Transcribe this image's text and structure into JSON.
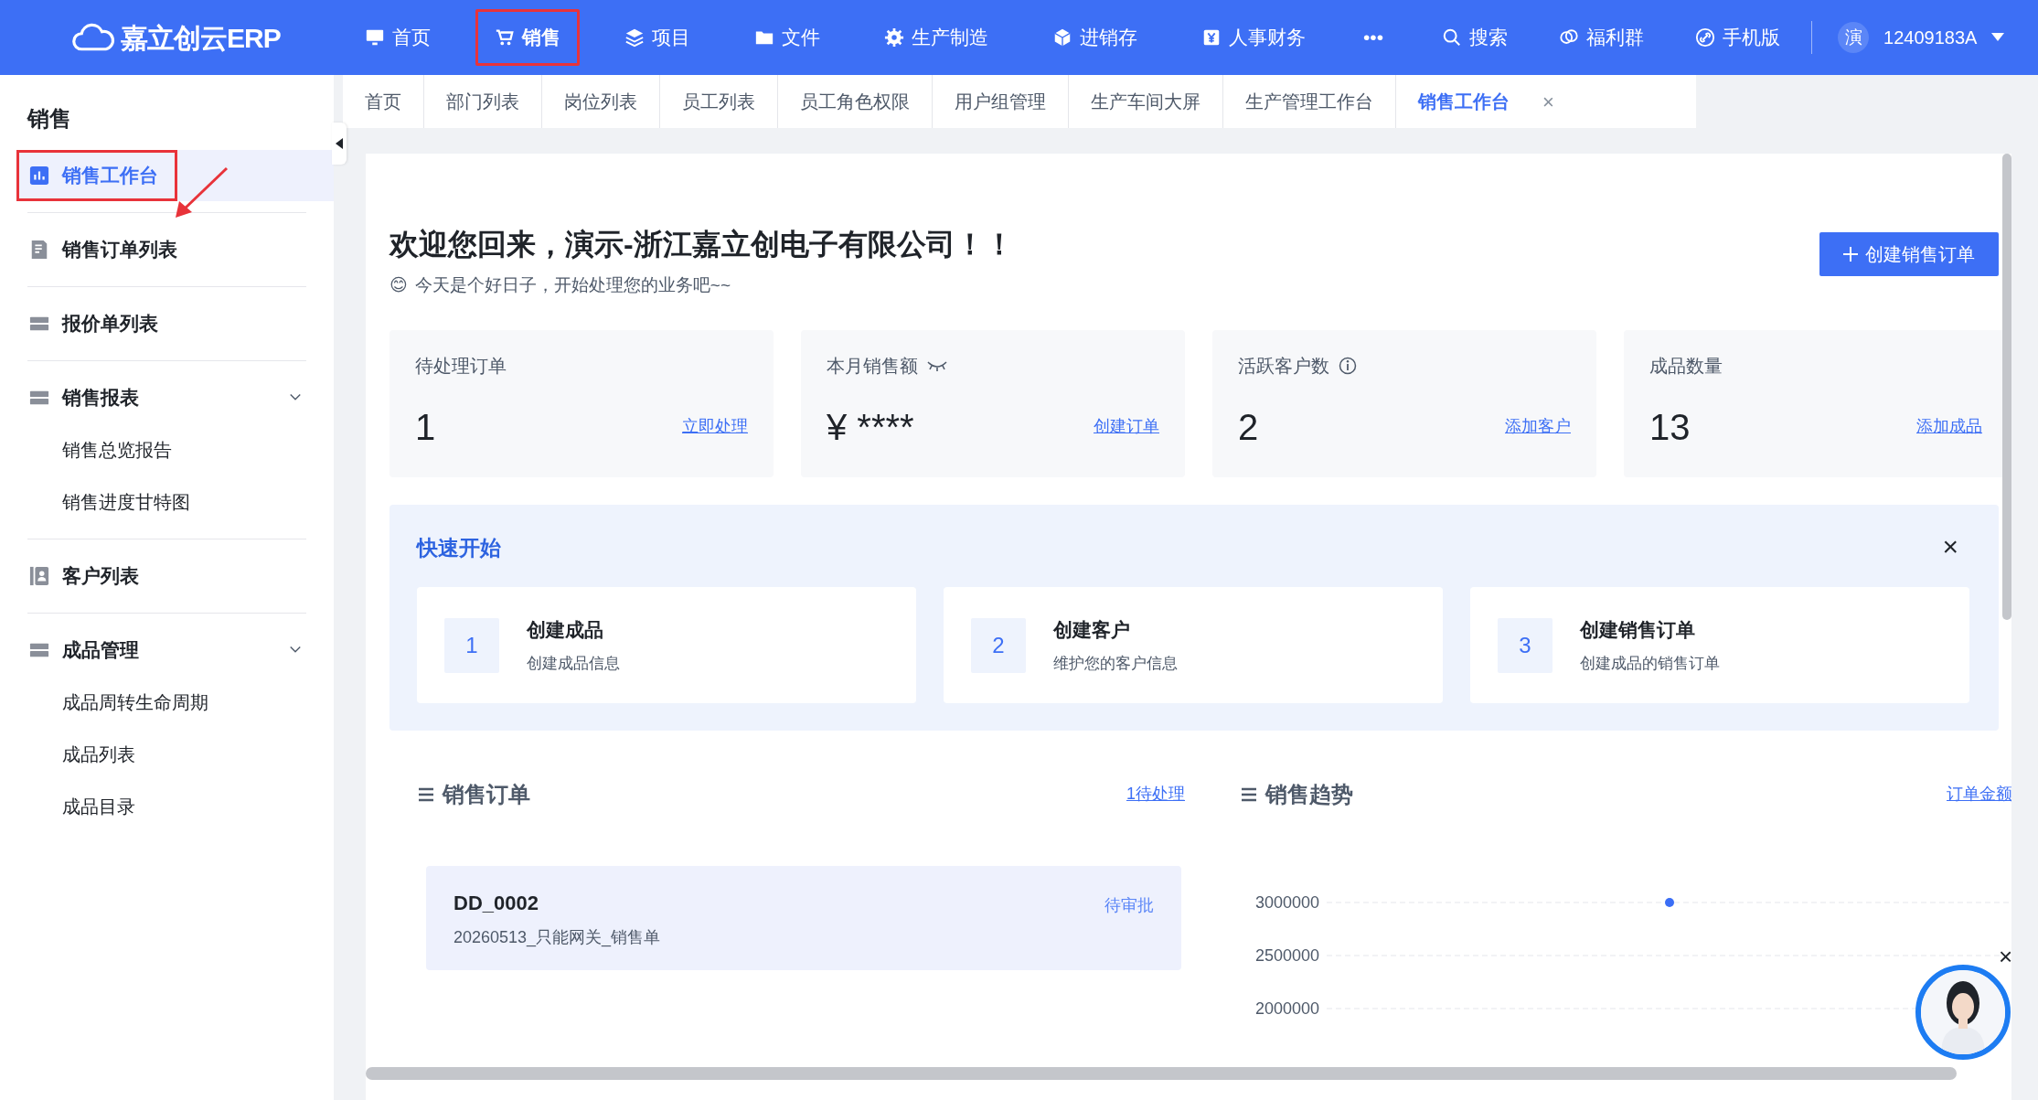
{
  "app": {
    "logo": "嘉立创云ERP"
  },
  "top_nav": [
    {
      "label": "首页",
      "selected": false,
      "highlighted": false
    },
    {
      "label": "销售",
      "selected": true,
      "highlighted": true
    },
    {
      "label": "项目",
      "selected": false,
      "highlighted": false
    },
    {
      "label": "文件",
      "selected": false,
      "highlighted": false
    },
    {
      "label": "生产制造",
      "selected": false,
      "highlighted": false
    },
    {
      "label": "进销存",
      "selected": false,
      "highlighted": false
    },
    {
      "label": "人事财务",
      "selected": false,
      "highlighted": false
    }
  ],
  "more": "•••",
  "tools": [
    {
      "label": "搜索"
    },
    {
      "label": "福利群"
    },
    {
      "label": "手机版"
    }
  ],
  "user": {
    "avatar": "演",
    "name": "12409183A"
  },
  "sidebar": {
    "title": "销售",
    "items": [
      {
        "kind": "link",
        "label": "销售工作台",
        "selected": true,
        "highlighted": true
      },
      {
        "kind": "link",
        "label": "销售订单列表",
        "selected": false,
        "highlighted": false
      },
      {
        "kind": "link",
        "label": "报价单列表",
        "selected": false,
        "highlighted": false
      },
      {
        "kind": "group",
        "label": "销售报表",
        "selected": false,
        "highlighted": false,
        "expanded": true,
        "children": [
          {
            "label": "销售总览报告"
          },
          {
            "label": "销售进度甘特图"
          }
        ]
      },
      {
        "kind": "link",
        "label": "客户列表",
        "selected": false,
        "highlighted": false
      },
      {
        "kind": "group",
        "label": "成品管理",
        "selected": false,
        "highlighted": false,
        "expanded": true,
        "children": [
          {
            "label": "成品周转生命周期"
          },
          {
            "label": "成品列表"
          },
          {
            "label": "成品目录"
          }
        ]
      }
    ]
  },
  "tabs": [
    {
      "label": "首页",
      "selected": false
    },
    {
      "label": "部门列表",
      "selected": false
    },
    {
      "label": "岗位列表",
      "selected": false
    },
    {
      "label": "员工列表",
      "selected": false
    },
    {
      "label": "员工角色权限",
      "selected": false
    },
    {
      "label": "用户组管理",
      "selected": false
    },
    {
      "label": "生产车间大屏",
      "selected": false
    },
    {
      "label": "生产管理工作台",
      "selected": false
    },
    {
      "label": "销售工作台",
      "selected": true,
      "close": "×"
    }
  ],
  "welcome": {
    "title": "欢迎您回来，演示-浙江嘉立创电子有限公司！！",
    "emoji": "😊",
    "subtitle": "今天是个好日子，开始处理您的业务吧~~"
  },
  "create_button": "创建销售订单",
  "stats": [
    {
      "kind": "plain",
      "label": "待处理订单",
      "value": "1",
      "action": "立即处理"
    },
    {
      "kind": "hidden",
      "label": "本月销售额",
      "value": "¥ ****",
      "action": "创建订单"
    },
    {
      "kind": "info",
      "label": "活跃客户数",
      "value": "2",
      "action": "添加客户"
    },
    {
      "kind": "plain",
      "label": "成品数量",
      "value": "13",
      "action": "添加成品"
    }
  ],
  "quick_start": {
    "title": "快速开始",
    "close": "×",
    "steps": [
      {
        "number": "1",
        "title": "创建成品",
        "desc": "创建成品信息"
      },
      {
        "number": "2",
        "title": "创建客户",
        "desc": "维护您的客户信息"
      },
      {
        "number": "3",
        "title": "创建销售订单",
        "desc": "创建成品的销售订单"
      }
    ]
  },
  "orders": {
    "title": "销售订单",
    "link": "1待处理",
    "items": [
      {
        "code": "DD_0002",
        "status": "待审批",
        "desc": "20260513_只能网关_销售单"
      }
    ]
  },
  "trend": {
    "title": "销售趋势",
    "link": "订单金额",
    "chart_data": {
      "type": "line",
      "categories": [
        null,
        null,
        null
      ],
      "yticks": [
        2000000,
        2500000,
        3000000
      ],
      "ylim": [
        2000000,
        3000000
      ],
      "series": [
        {
          "color": "#3b6ef6",
          "marker": true,
          "values": [
            null,
            3000000,
            null
          ]
        }
      ]
    }
  },
  "assistant": {
    "close": "×"
  }
}
